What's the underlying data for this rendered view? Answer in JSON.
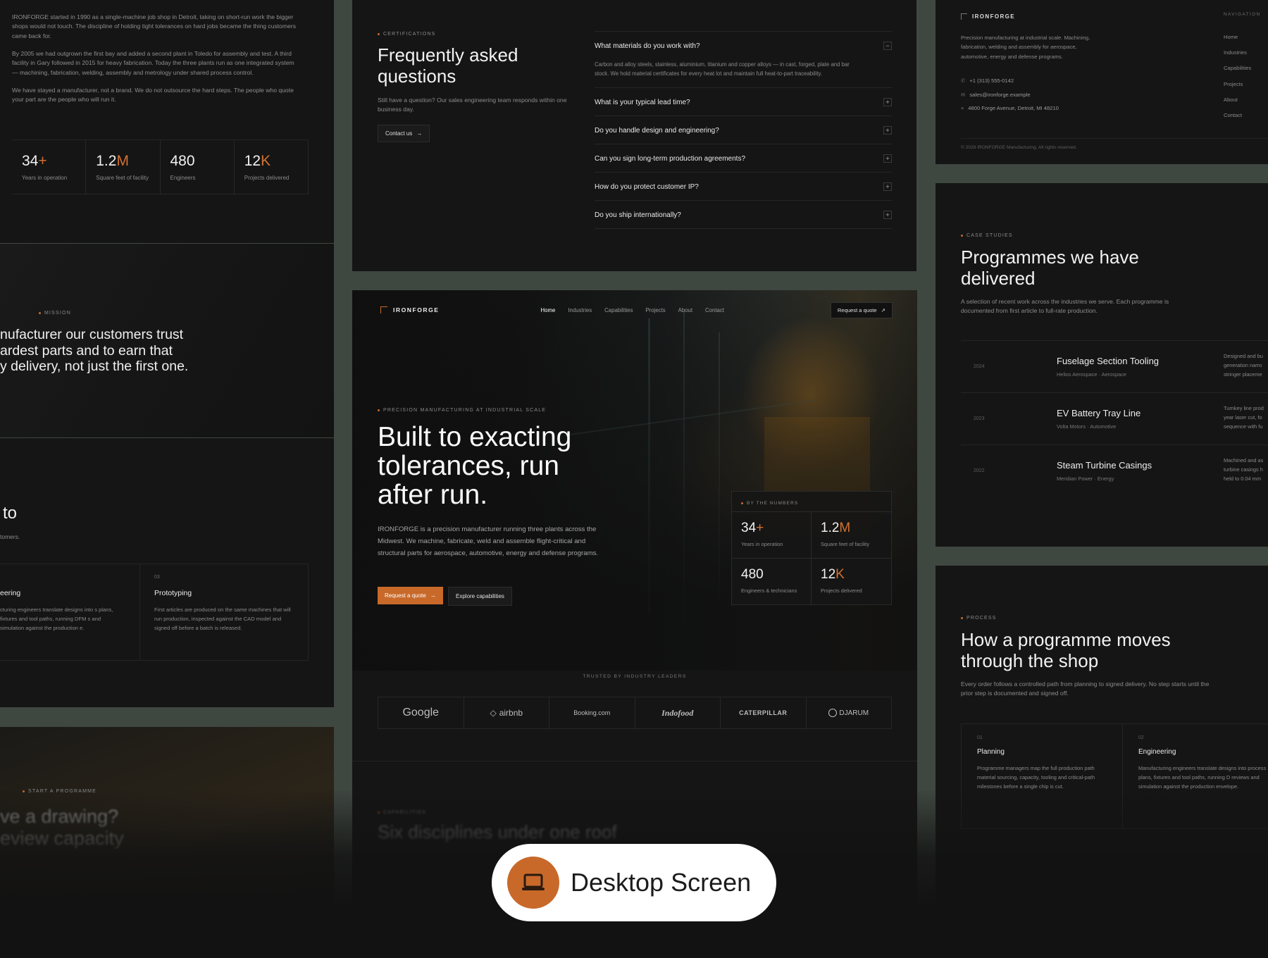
{
  "about_panel": {
    "paragraphs": [
      "IRONFORGE started in 1990 as a single-machine job shop in Detroit, taking on short-run work the bigger shops would not touch. The discipline of holding tight tolerances on hard jobs became the thing customers came back for.",
      "By 2005 we had outgrown the first bay and added a second plant in Toledo for assembly and test. A third facility in Gary followed in 2015 for heavy fabrication. Today the three plants run as one integrated system — machining, fabrication, welding, assembly and metrology under shared process control.",
      "We have stayed a manufacturer, not a brand. We do not outsource the hard steps. The people who quote your part are the people who will run it."
    ],
    "stats": [
      {
        "num": "34",
        "suffix": "+",
        "label": "Years in operation"
      },
      {
        "num": "1.2",
        "suffix": "M",
        "label": "Square feet of facility"
      },
      {
        "num": "480",
        "suffix": "",
        "label": "Engineers"
      },
      {
        "num": "12",
        "suffix": "K",
        "label": "Projects delivered"
      }
    ]
  },
  "mission_panel": {
    "eyebrow": "Mission",
    "lines": [
      "nufacturer our customers trust",
      "ardest parts and to earn that",
      "y delivery, not just the first one."
    ]
  },
  "capabilities_panel": {
    "heading_fragment": "to",
    "sub_fragment": "tomers.",
    "cards": [
      {
        "num": "",
        "title": "eering",
        "text": "cturing engineers translate designs into s plans, fixtures and tool paths, running DFM s and simulation against the production e."
      },
      {
        "num": "03",
        "title": "Prototyping",
        "text": "First articles are produced on the same machines that will run production, inspected against the CAD model and signed off before a batch is released."
      }
    ]
  },
  "cta_panel": {
    "eyebrow": "Start a programme",
    "heading_fragment": "ve a drawing?",
    "heading_fragment_2": "eview capacity"
  },
  "faq_panel": {
    "eyebrow": "Certifications",
    "title": "Frequently asked questions",
    "text": "Still have a question? Our sales engineering team responds within one business day.",
    "contact_label": "Contact us",
    "items": [
      {
        "q": "What materials do you work with?",
        "a": "Carbon and alloy steels, stainless, aluminium, titanium and copper alloys — in cast, forged, plate and bar stock. We hold material certificates for every heat lot and maintain full heat-to-part traceability.",
        "icon": "−"
      },
      {
        "q": "What is your typical lead time?",
        "a": "",
        "icon": "+"
      },
      {
        "q": "Do you handle design and engineering?",
        "a": "",
        "icon": "+"
      },
      {
        "q": "Can you sign long-term production agreements?",
        "a": "",
        "icon": "+"
      },
      {
        "q": "How do you protect customer IP?",
        "a": "",
        "icon": "+"
      },
      {
        "q": "Do you ship internationally?",
        "a": "",
        "icon": "+"
      }
    ]
  },
  "hero_panel": {
    "brand": "IRONFORGE",
    "nav": [
      "Home",
      "Industries",
      "Capabilities",
      "Projects",
      "About",
      "Contact"
    ],
    "quote_label": "Request a quote",
    "eyebrow": "Precision manufacturing at industrial scale",
    "headline_lines": [
      "Built to exacting",
      "tolerances, run",
      "after run."
    ],
    "text": "IRONFORGE is a precision manufacturer running three plants across the Midwest. We machine, fabricate, weld and assemble flight-critical and structural parts for aerospace, automotive, energy and defense programs.",
    "primary_cta": "Request a quote",
    "secondary_cta": "Explore capabilities",
    "numbers_label": "By the numbers",
    "numbers": [
      {
        "num": "34",
        "suffix": "+",
        "label": "Years in operation"
      },
      {
        "num": "1.2",
        "suffix": "M",
        "label": "Square feet of facility"
      },
      {
        "num": "480",
        "suffix": "",
        "label": "Engineers & technicians"
      },
      {
        "num": "12",
        "suffix": "K",
        "label": "Projects delivered"
      }
    ],
    "trusted_label": "Trusted by industry leaders",
    "logos": [
      "Google",
      "airbnb",
      "Booking.com",
      "Indofood",
      "CATERPILLAR",
      "DJARUM"
    ],
    "next_eyebrow": "Capabilities",
    "next_heading": "Six disciplines under one roof"
  },
  "footer_panel": {
    "brand": "IRONFORGE",
    "text": "Precision manufacturing at industrial scale. Machining, fabrication, welding and assembly for aerospace, automotive, energy and defense programs.",
    "phone": "+1 (313) 555-0142",
    "email": "sales@ironforge.example",
    "address": "4800 Forge Avenue, Detroit, MI 48210",
    "copyright": "© 2026 IRONFORGE Manufacturing. All rights reserved.",
    "nav_title": "Navigation",
    "nav": [
      "Home",
      "Industries",
      "Capabilities",
      "Projects",
      "About",
      "Contact"
    ]
  },
  "case_panel": {
    "eyebrow": "Case studies",
    "title": "Programmes we have delivered",
    "text": "A selection of recent work across the industries we serve. Each programme is documented from first article to full-rate production.",
    "rows": [
      {
        "year": "2024",
        "title": "Fuselage Section Tooling",
        "meta": "Helios Aerospace · Aerospace",
        "desc": "Designed and bu generation narro stringer placeme"
      },
      {
        "year": "2023",
        "title": "EV Battery Tray Line",
        "meta": "Volta Motors · Automotive",
        "desc": "Turnkey line prod year laser cut, fo sequence with fu"
      },
      {
        "year": "2022",
        "title": "Steam Turbine Casings",
        "meta": "Meridian Power · Energy",
        "desc": "Machined and as turbine casings h held to 0.04 mm"
      }
    ]
  },
  "process_panel": {
    "eyebrow": "Process",
    "title": "How a programme moves through the shop",
    "text": "Every order follows a controlled path from planning to signed delivery. No step starts until the prior step is documented and signed off.",
    "steps": [
      {
        "num": "01",
        "title": "Planning",
        "text": "Programme managers map the full production path material sourcing, capacity, tooling and critical-path milestones before a single chip is cut."
      },
      {
        "num": "02",
        "title": "Engineering",
        "text": "Manufacturing engineers translate designs into process plans, fixtures and tool paths, running D reviews and simulation against the production envelope."
      }
    ]
  },
  "badge": {
    "label": "Desktop Screen"
  }
}
